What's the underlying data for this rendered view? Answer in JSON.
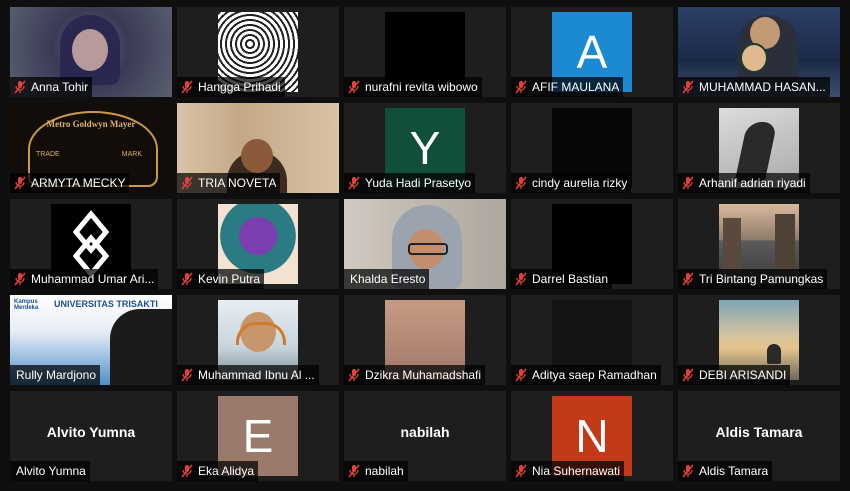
{
  "colors": {
    "active_border": "#d6df42",
    "mic_muted": "#e0413a",
    "tile_bg": "#1e1e1e"
  },
  "participants": [
    {
      "name": "Anna Tohir"
    },
    {
      "name": "Hangga Prihadi"
    },
    {
      "name": "nurafni revita wibowo"
    },
    {
      "name": "AFIF MAULANA",
      "avatar_letter": "A"
    },
    {
      "name": "MUHAMMAD HASAN..."
    },
    {
      "name": "ARMYTA MECKY"
    },
    {
      "name": "TRIA NOVETA"
    },
    {
      "name": "Yuda Hadi Prasetyo",
      "avatar_letter": "Y"
    },
    {
      "name": "cindy aurelia rizky"
    },
    {
      "name": "Arhanif adrian riyadi"
    },
    {
      "name": "Muhammad Umar Ari..."
    },
    {
      "name": "Kevin Putra"
    },
    {
      "name": "Khalda Eresto",
      "active": true
    },
    {
      "name": "Darrel Bastian"
    },
    {
      "name": "Tri Bintang Pamungkas"
    },
    {
      "name": "Rully Mardjono"
    },
    {
      "name": "Muhammad Ibnu Al ..."
    },
    {
      "name": "Dzikra Muhamadshafi"
    },
    {
      "name": "Aditya saep Ramadhan"
    },
    {
      "name": "DEBI ARISANDI"
    },
    {
      "name": "Alvito Yumna",
      "display_name": "Alvito Yumna"
    },
    {
      "name": "Eka Alidya",
      "avatar_letter": "E"
    },
    {
      "name": "nabilah",
      "display_name": "nabilah"
    },
    {
      "name": "Nia Suhernawati",
      "avatar_letter": "N"
    },
    {
      "name": "Aldis Tamara",
      "display_name": "Aldis Tamara"
    }
  ],
  "overlay_text": {
    "mgm_line1": "Metro Goldwyn Mayer",
    "mgm_trade": "TRADE",
    "mgm_mark": "MARK",
    "univ_name": "UNIVERSITAS TRISAKTI",
    "univ_badge": "Kampus Merdeka"
  }
}
